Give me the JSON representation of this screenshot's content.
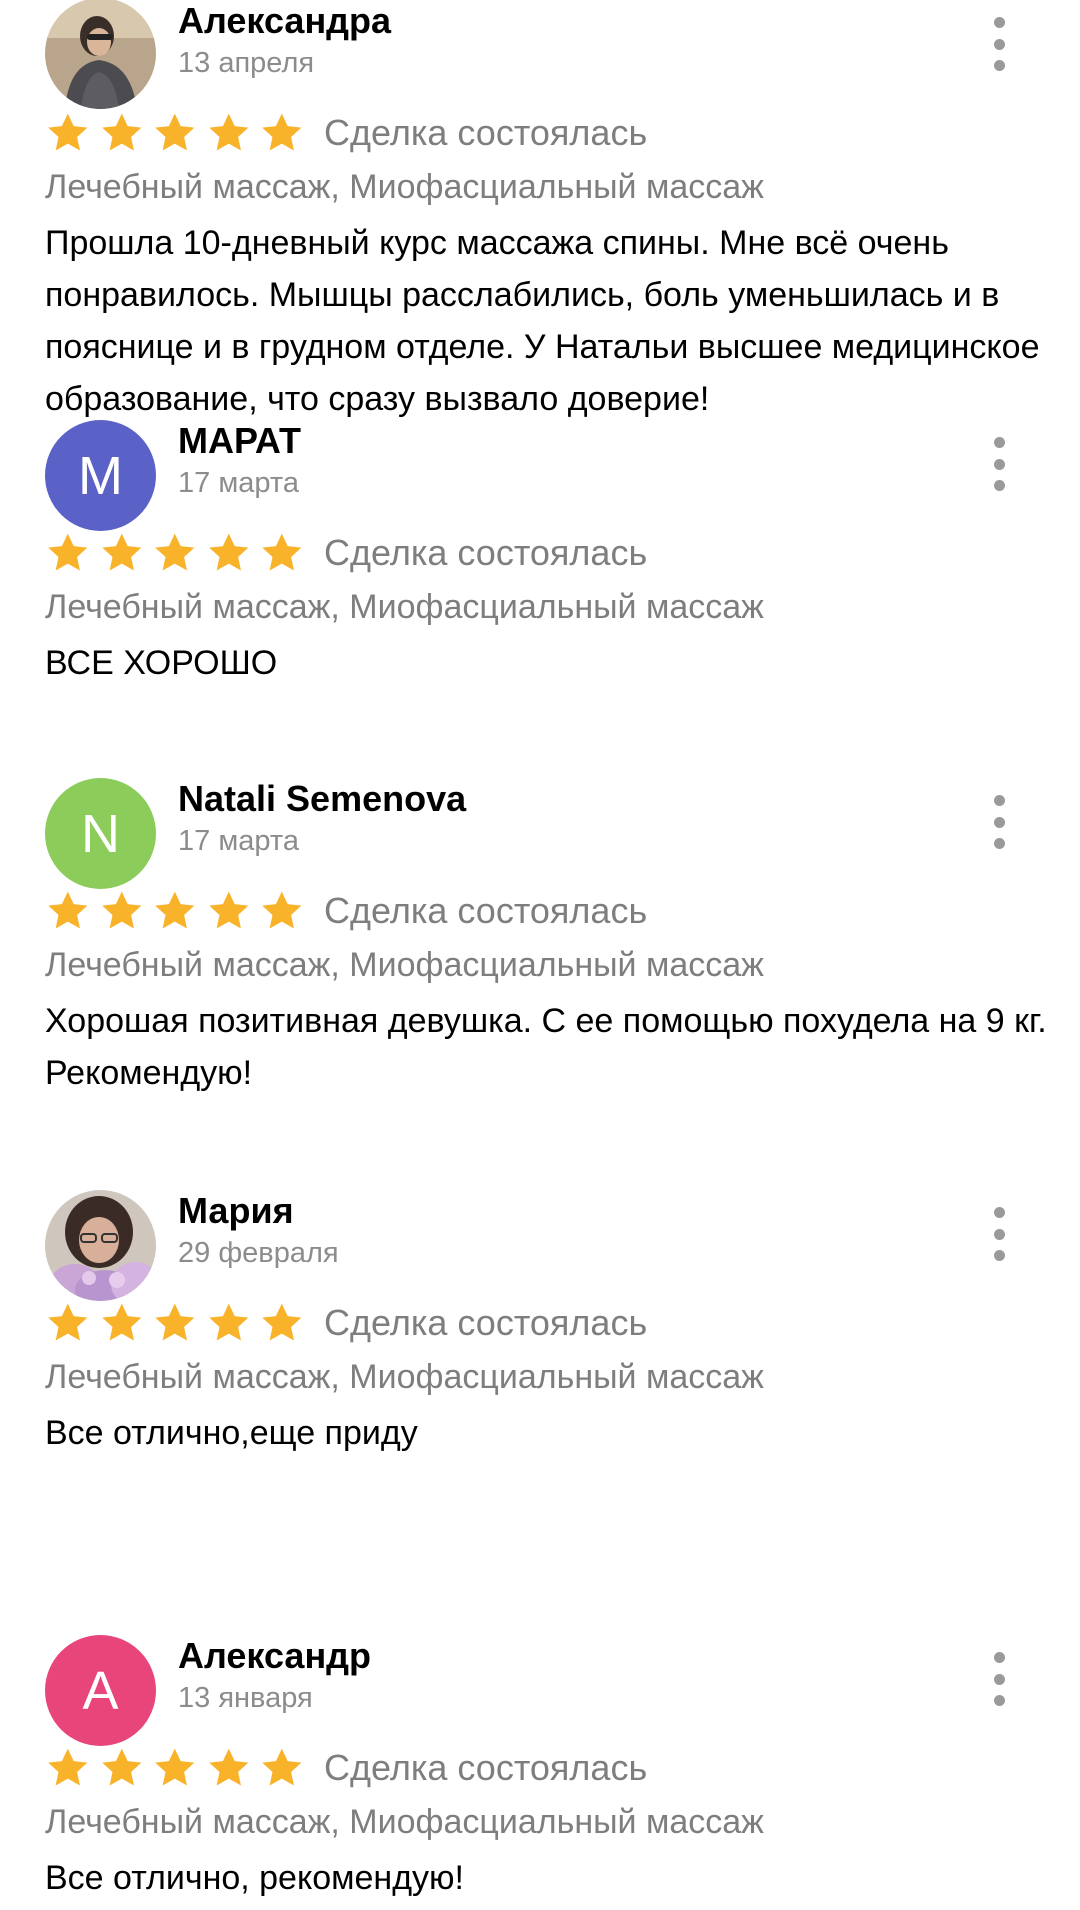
{
  "colors": {
    "star": "#f9b32a",
    "secondary_text": "#7e7e7e",
    "menu_dots": "#9a9a9a"
  },
  "reviews": [
    {
      "name": "Александра",
      "date": "13 апреля",
      "avatar": {
        "type": "photo",
        "icon": "user-photo"
      },
      "rating": 5,
      "deal_label": "Сделка состоялась",
      "services": "Лечебный массаж, Миофасциальный массаж",
      "text": "Прошла 10-дневный курс массажа спины.  Мне всё очень понравилось. Мышцы расслабились, боль уменьшилась и в пояснице и в грудном отделе. У Натальи высшее медицинское образование,  что сразу вызвало доверие!"
    },
    {
      "name": "МАРАТ",
      "date": "17 марта",
      "avatar": {
        "type": "letter",
        "letter": "М",
        "color": "#5a62c8"
      },
      "rating": 5,
      "deal_label": "Сделка состоялась",
      "services": "Лечебный массаж, Миофасциальный массаж",
      "text": "ВСЕ ХОРОШО"
    },
    {
      "name": "Natali Semenova",
      "date": "17 марта",
      "avatar": {
        "type": "letter",
        "letter": "N",
        "color": "#8bcc5b"
      },
      "rating": 5,
      "deal_label": "Сделка состоялась",
      "services": "Лечебный массаж, Миофасциальный массаж",
      "text": "Хорошая позитивная девушка. С ее помощью похудела на 9 кг. Рекомендую!"
    },
    {
      "name": "Мария",
      "date": "29 февраля",
      "avatar": {
        "type": "photo",
        "icon": "user-photo"
      },
      "rating": 5,
      "deal_label": "Сделка состоялась",
      "services": "Лечебный массаж, Миофасциальный массаж",
      "text": "Все отлично,еще приду"
    },
    {
      "name": "Александр",
      "date": "13 января",
      "avatar": {
        "type": "letter",
        "letter": "А",
        "color": "#e8467a"
      },
      "rating": 5,
      "deal_label": "Сделка состоялась",
      "services": "Лечебный массаж, Миофасциальный массаж",
      "text": "Все отлично, рекомендую!"
    }
  ]
}
